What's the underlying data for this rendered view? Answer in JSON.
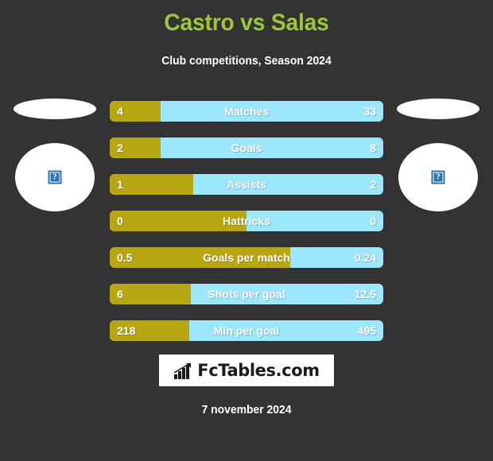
{
  "header": {
    "title": "Castro vs Salas",
    "subtitle": "Club competitions, Season 2024",
    "title_color": "#9fc53c"
  },
  "players": {
    "left": {
      "flag_alt": "flag-placeholder",
      "portrait_alt": "broken-image-placeholder"
    },
    "right": {
      "flag_alt": "flag-placeholder",
      "portrait_alt": "broken-image-placeholder"
    }
  },
  "footer": {
    "logo_text": "FcTables.com",
    "logo_icon": "bar-chart-arrow-icon",
    "date": "7 november 2024"
  },
  "chart_data": {
    "type": "bar",
    "title": "Castro vs Salas",
    "subtitle": "Club competitions, Season 2024",
    "orientation": "horizontal-diverging",
    "legend_position": "none",
    "grid": false,
    "colors": {
      "left_series": "#b8a713",
      "right_series": "#9ce7fb",
      "background": "#333333"
    },
    "series": [
      {
        "name": "Castro",
        "side": "left",
        "color": "#b8a713"
      },
      {
        "name": "Salas",
        "side": "right",
        "color": "#9ce7fb"
      }
    ],
    "categories": [
      "Matches",
      "Goals",
      "Assists",
      "Hattricks",
      "Goals per match",
      "Shots per goal",
      "Min per goal"
    ],
    "rows": [
      {
        "label": "Matches",
        "left": "4",
        "right": "33",
        "left_pct": 18.6
      },
      {
        "label": "Goals",
        "left": "2",
        "right": "8",
        "left_pct": 18.6
      },
      {
        "label": "Assists",
        "left": "1",
        "right": "2",
        "left_pct": 30.5
      },
      {
        "label": "Hattricks",
        "left": "0",
        "right": "0",
        "left_pct": 50.0
      },
      {
        "label": "Goals per match",
        "left": "0.5",
        "right": "0.24",
        "left_pct": 66.0
      },
      {
        "label": "Shots per goal",
        "left": "6",
        "right": "12.5",
        "left_pct": 29.7
      },
      {
        "label": "Min per goal",
        "left": "218",
        "right": "495",
        "left_pct": 29.1
      }
    ]
  }
}
